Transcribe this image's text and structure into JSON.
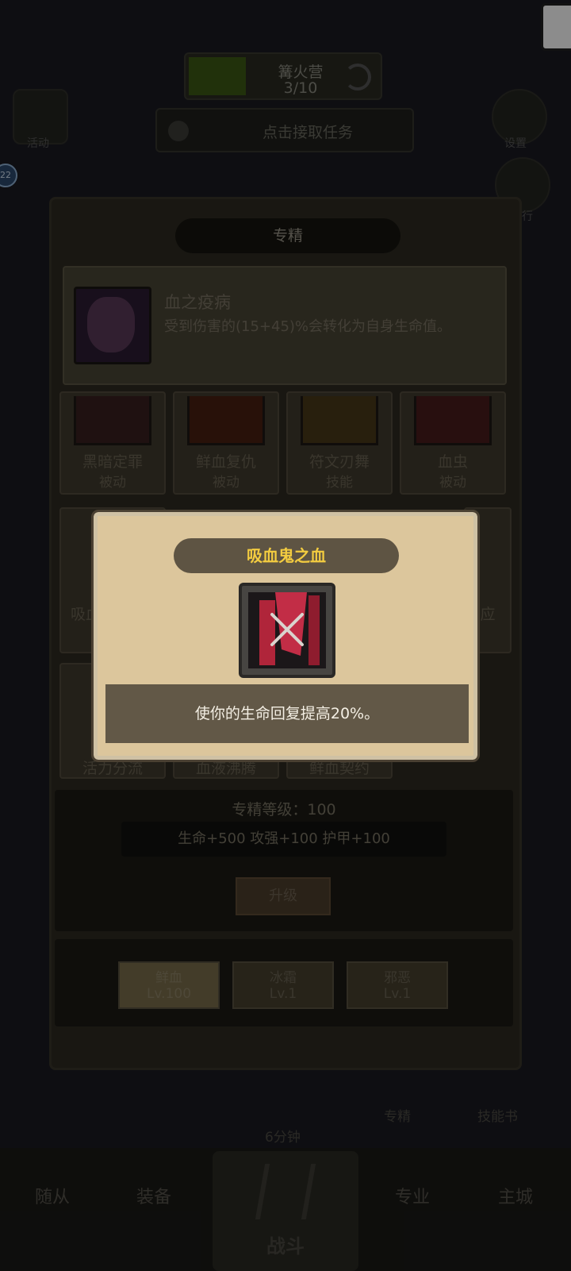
{
  "hud": {
    "res_title": "篝火营",
    "res_count": "3/10",
    "task_text": "点击接取任务",
    "left_label": "活动",
    "right_label": "设置",
    "right_label_2": "排行",
    "badge": "22"
  },
  "panel": {
    "title": "专精",
    "info": {
      "name": "血之疫病",
      "desc": "受到伤害的(15+45)%会转化为自身生命值。"
    },
    "row1": [
      {
        "name": "黑暗定罪",
        "kind": "被动"
      },
      {
        "name": "鲜血复仇",
        "kind": "被动"
      },
      {
        "name": "符文刃舞",
        "kind": "技能"
      },
      {
        "name": "血虫",
        "kind": "被动"
      }
    ],
    "row2": [
      {
        "name": "吸血"
      },
      {
        "name": "应"
      }
    ],
    "row3": [
      {
        "name": "活力分流"
      },
      {
        "name": "血液沸腾"
      },
      {
        "name": "鲜血契约"
      }
    ],
    "level_label": "专精等级：100",
    "bonus": "生命+500  攻强+100  护甲+100",
    "upgrade": "升级",
    "tabs": [
      {
        "name": "鲜血",
        "level": "Lv.100"
      },
      {
        "name": "冰霜",
        "level": "Lv.1"
      },
      {
        "name": "邪恶",
        "level": "Lv.1"
      }
    ]
  },
  "mid": {
    "timer": "6分钟",
    "spec": "专精",
    "skillbook": "技能书"
  },
  "nav": {
    "items": [
      "随从",
      "装备",
      "战斗",
      "专业",
      "主城"
    ]
  },
  "popup": {
    "title": "吸血鬼之血",
    "desc": "使你的生命回复提高20%。"
  }
}
